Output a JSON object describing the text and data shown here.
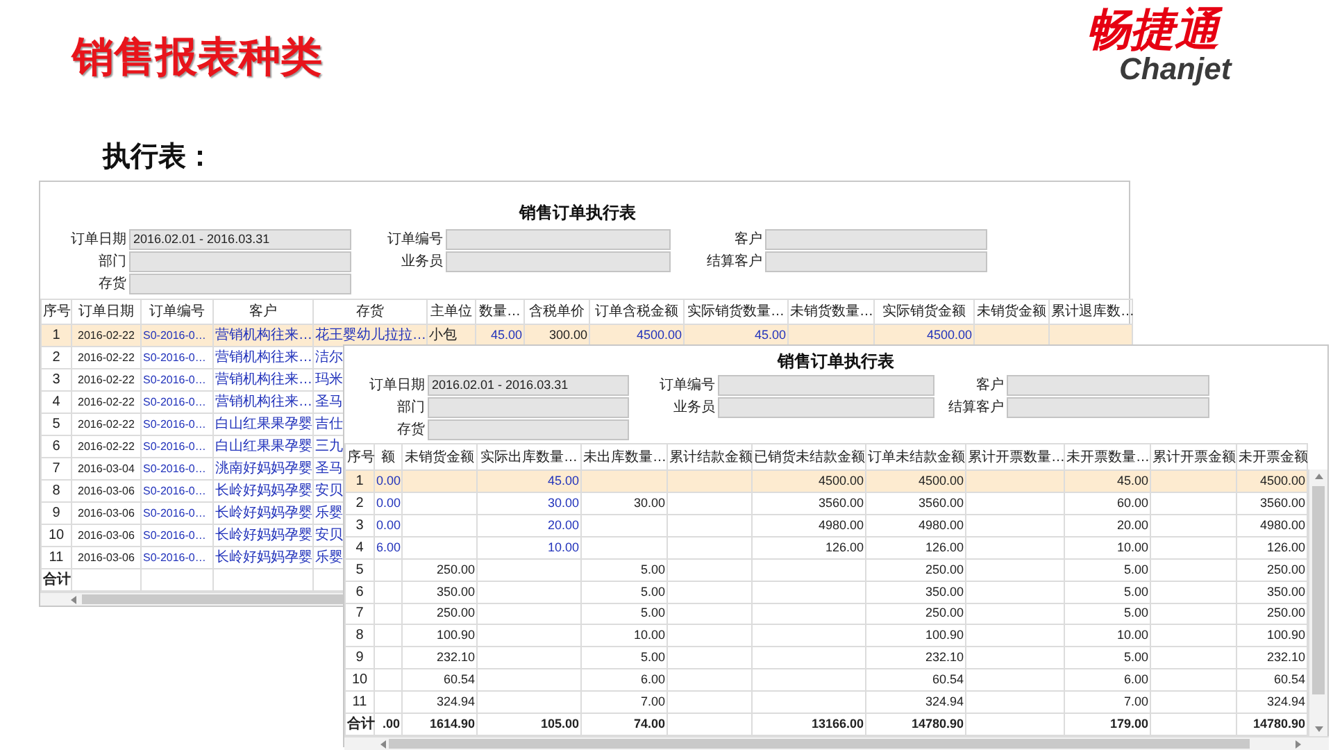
{
  "slide": {
    "title": "销售报表种类",
    "subtitle": "执行表："
  },
  "logo": {
    "name": "畅捷通",
    "latin": "Chanjet"
  },
  "reports": [
    {
      "title": "销售订单执行表",
      "filters": [
        {
          "label": "订单日期",
          "value": "2016.02.01 - 2016.03.31"
        },
        {
          "label": "订单编号"
        },
        {
          "label": "客户"
        },
        {
          "label": "部门"
        },
        {
          "label": "业务员"
        },
        {
          "label": "结算客户"
        },
        {
          "label": "存货"
        }
      ],
      "columns": [
        {
          "label": "序号",
          "kind": "index"
        },
        {
          "label": "订单日期",
          "kind": "date"
        },
        {
          "label": "订单编号",
          "kind": "code",
          "link": true
        },
        {
          "label": "客户",
          "kind": "text",
          "link": true
        },
        {
          "label": "存货",
          "kind": "text",
          "link": true
        },
        {
          "label": "主单位",
          "kind": "text"
        },
        {
          "label": "数量…",
          "kind": "number",
          "link": true
        },
        {
          "label": "含税单价",
          "kind": "number"
        },
        {
          "label": "订单含税金额",
          "kind": "number",
          "link": true
        },
        {
          "label": "实际销货数量…",
          "kind": "number",
          "link": true
        },
        {
          "label": "未销货数量…",
          "kind": "number"
        },
        {
          "label": "实际销货金额",
          "kind": "number",
          "link": true
        },
        {
          "label": "未销货金额",
          "kind": "number"
        },
        {
          "label": "累计退库数…",
          "kind": "number"
        }
      ],
      "rows": [
        {
          "selected": true,
          "cells": [
            "1",
            "2016-02-22",
            "S0-2016-0…",
            "营销机构往来…",
            "花王婴幼儿拉拉…",
            "小包",
            "45.00",
            "300.00",
            "4500.00",
            "45.00",
            null,
            "4500.00",
            null,
            null
          ]
        },
        {
          "selected": false,
          "cells": [
            "2",
            "2016-02-22",
            "S0-2016-0…",
            "营销机构往来…",
            "洁尔"
          ]
        },
        {
          "selected": false,
          "cells": [
            "3",
            "2016-02-22",
            "S0-2016-0…",
            "营销机构往来…",
            "玛米"
          ]
        },
        {
          "selected": false,
          "cells": [
            "4",
            "2016-02-22",
            "S0-2016-0…",
            "营销机构往来…",
            "圣马"
          ]
        },
        {
          "selected": false,
          "cells": [
            "5",
            "2016-02-22",
            "S0-2016-0…",
            "白山红果果孕婴",
            "吉仕"
          ]
        },
        {
          "selected": false,
          "cells": [
            "6",
            "2016-02-22",
            "S0-2016-0…",
            "白山红果果孕婴",
            "三九"
          ]
        },
        {
          "selected": false,
          "cells": [
            "7",
            "2016-03-04",
            "S0-2016-0…",
            "洮南好妈妈孕婴",
            "圣马"
          ]
        },
        {
          "selected": false,
          "cells": [
            "8",
            "2016-03-06",
            "S0-2016-0…",
            "长岭好妈妈孕婴",
            "安贝"
          ]
        },
        {
          "selected": false,
          "cells": [
            "9",
            "2016-03-06",
            "S0-2016-0…",
            "长岭好妈妈孕婴",
            "乐婴"
          ]
        },
        {
          "selected": false,
          "cells": [
            "10",
            "2016-03-06",
            "S0-2016-0…",
            "长岭好妈妈孕婴",
            "安贝"
          ]
        },
        {
          "selected": false,
          "cells": [
            "11",
            "2016-03-06",
            "S0-2016-0…",
            "长岭好妈妈孕婴",
            "乐婴"
          ]
        }
      ],
      "total": {
        "cells": [
          "合计"
        ]
      }
    },
    {
      "title": "销售订单执行表",
      "filters": [
        {
          "label": "订单日期",
          "value": "2016.02.01 - 2016.03.31"
        },
        {
          "label": "订单编号"
        },
        {
          "label": "客户"
        },
        {
          "label": "部门"
        },
        {
          "label": "业务员"
        },
        {
          "label": "结算客户"
        },
        {
          "label": "存货"
        }
      ],
      "columns": [
        {
          "label": "序号",
          "kind": "index"
        },
        {
          "label": "额",
          "kind": "number",
          "link": true
        },
        {
          "label": "未销货金额",
          "kind": "number"
        },
        {
          "label": "实际出库数量…",
          "kind": "number",
          "link": true
        },
        {
          "label": "未出库数量…",
          "kind": "number"
        },
        {
          "label": "累计结款金额",
          "kind": "number"
        },
        {
          "label": "已销货未结款金额",
          "kind": "number"
        },
        {
          "label": "订单未结款金额",
          "kind": "number"
        },
        {
          "label": "累计开票数量…",
          "kind": "number"
        },
        {
          "label": "未开票数量…",
          "kind": "number"
        },
        {
          "label": "累计开票金额",
          "kind": "number"
        },
        {
          "label": "未开票金额",
          "kind": "number"
        }
      ],
      "rows": [
        {
          "selected": true,
          "cells": [
            "1",
            "0.00",
            null,
            "45.00",
            null,
            null,
            "4500.00",
            "4500.00",
            null,
            "45.00",
            null,
            "4500.00"
          ]
        },
        {
          "selected": false,
          "cells": [
            "2",
            "0.00",
            null,
            "30.00",
            "30.00",
            null,
            "3560.00",
            "3560.00",
            null,
            "60.00",
            null,
            "3560.00"
          ]
        },
        {
          "selected": false,
          "cells": [
            "3",
            "0.00",
            null,
            "20.00",
            null,
            null,
            "4980.00",
            "4980.00",
            null,
            "20.00",
            null,
            "4980.00"
          ]
        },
        {
          "selected": false,
          "cells": [
            "4",
            "6.00",
            null,
            "10.00",
            null,
            null,
            "126.00",
            "126.00",
            null,
            "10.00",
            null,
            "126.00"
          ]
        },
        {
          "selected": false,
          "cells": [
            "5",
            null,
            "250.00",
            null,
            "5.00",
            null,
            null,
            "250.00",
            null,
            "5.00",
            null,
            "250.00"
          ]
        },
        {
          "selected": false,
          "cells": [
            "6",
            null,
            "350.00",
            null,
            "5.00",
            null,
            null,
            "350.00",
            null,
            "5.00",
            null,
            "350.00"
          ]
        },
        {
          "selected": false,
          "cells": [
            "7",
            null,
            "250.00",
            null,
            "5.00",
            null,
            null,
            "250.00",
            null,
            "5.00",
            null,
            "250.00"
          ]
        },
        {
          "selected": false,
          "cells": [
            "8",
            null,
            "100.90",
            null,
            "10.00",
            null,
            null,
            "100.90",
            null,
            "10.00",
            null,
            "100.90"
          ]
        },
        {
          "selected": false,
          "cells": [
            "9",
            null,
            "232.10",
            null,
            "5.00",
            null,
            null,
            "232.10",
            null,
            "5.00",
            null,
            "232.10"
          ]
        },
        {
          "selected": false,
          "cells": [
            "10",
            null,
            "60.54",
            null,
            "6.00",
            null,
            null,
            "60.54",
            null,
            "6.00",
            null,
            "60.54"
          ]
        },
        {
          "selected": false,
          "cells": [
            "11",
            null,
            "324.94",
            null,
            "7.00",
            null,
            null,
            "324.94",
            null,
            "7.00",
            null,
            "324.94"
          ]
        }
      ],
      "total": {
        "cells": [
          "合计",
          ".00",
          "1614.90",
          "105.00",
          "74.00",
          null,
          "13166.00",
          "14780.90",
          null,
          "179.00",
          null,
          "14780.90"
        ]
      }
    }
  ]
}
